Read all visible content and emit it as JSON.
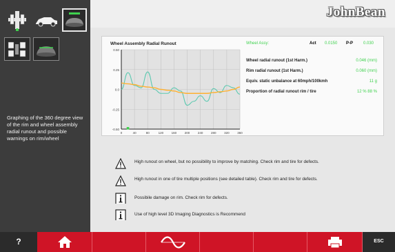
{
  "header": {
    "brand": "JohnBean"
  },
  "sidebar": {
    "tools": [
      {
        "icon": "wheel-balancer-icon",
        "selected": false
      },
      {
        "icon": "car-icon",
        "selected": false
      },
      {
        "icon": "wheel-runout-icon",
        "selected": true
      },
      {
        "icon": "tire-positions-icon",
        "selected": false
      },
      {
        "icon": "tire-scan-icon",
        "selected": false
      }
    ],
    "description": "Graphing of the 360 degree view of the rim and wheel assembly radial runout and possible warnings on rim/wheel"
  },
  "panel": {
    "chart_title": "Wheel Assembly Radial Runout",
    "measure_header": {
      "label": "Wheel Assy:",
      "act_label": "Act",
      "act_value": "0.0150",
      "pp_label": "P-P",
      "pp_value": "0.030"
    },
    "rows": [
      {
        "label": "Wheel radial runout (1st Harm.)",
        "value": "0.046 (mm)"
      },
      {
        "label": "Rim radial runout (1st Harm.)",
        "value": "0.060 (mm)"
      },
      {
        "label": "Equiv. static unbalance at 60mph/100kmh",
        "value": "11 g"
      },
      {
        "label": "Proportion of radial runout rim / tire",
        "value": "12 % 88 %"
      }
    ]
  },
  "chart_data": {
    "type": "line",
    "x": [
      0,
      20,
      40,
      60,
      80,
      100,
      120,
      140,
      160,
      180,
      200,
      220,
      240,
      260,
      280,
      300,
      320,
      340,
      360
    ],
    "xlabel": "",
    "ylabel": "",
    "xlim": [
      0,
      360
    ],
    "ylim": [
      -0.5,
      0.5
    ],
    "yticks": [
      "0.50",
      "0.25",
      "0.0",
      "-0.25",
      "-0.50"
    ],
    "xticks": [
      "0",
      "40",
      "80",
      "120",
      "160",
      "200",
      "240",
      "280",
      "320",
      "360"
    ],
    "grid": true,
    "series": [
      {
        "color": "#5cc9b0",
        "values": [
          0.0,
          0.21,
          0.05,
          0.02,
          0.22,
          0.0,
          -0.05,
          -0.05,
          0.02,
          -0.02,
          -0.2,
          -0.15,
          -0.08,
          -0.15,
          0.01,
          -0.04,
          0.05,
          0.02,
          -0.06
        ]
      },
      {
        "color": "#ffb030",
        "values": [
          0.08,
          0.07,
          0.06,
          0.04,
          0.03,
          0.02,
          0.0,
          -0.01,
          -0.02,
          -0.04,
          -0.05,
          -0.05,
          -0.05,
          -0.05,
          -0.04,
          -0.03,
          -0.02,
          0.0,
          0.03
        ]
      }
    ],
    "marker_x": 20,
    "marker_color": "#3fd14e"
  },
  "warnings": [
    {
      "icon": "warning-triangle-icon",
      "text": "High runout on wheel, but no possibility to improve by matching. Check rim and tire for defects."
    },
    {
      "icon": "warning-triangle-icon",
      "text": "High runout in one of tire multiple positions (see detailed table). Check rim and tire for defects."
    },
    {
      "icon": "info-icon",
      "text": "Possibile damage on rim. Check rim for defects."
    },
    {
      "icon": "info-icon",
      "text": "Use of high level 3D Imaging Diagnostics is Recommend"
    }
  ],
  "bottom_bar": {
    "help_label": "?",
    "esc_label": "ESC"
  }
}
